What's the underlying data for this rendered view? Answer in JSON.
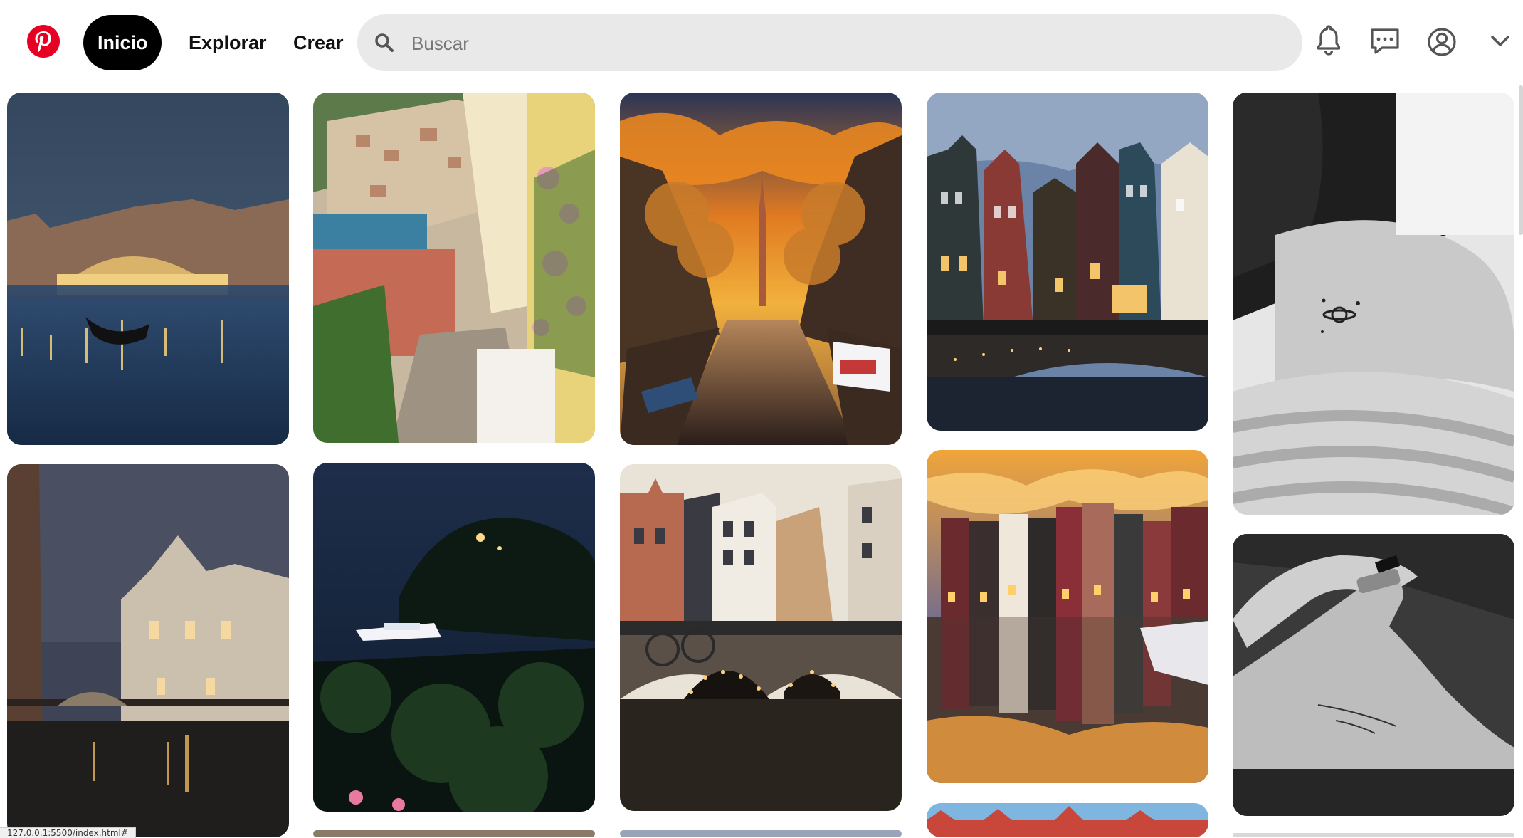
{
  "brand": {
    "logo_icon": "pinterest-logo-icon",
    "color": "#e60023"
  },
  "nav": {
    "home_label": "Inicio",
    "explore_label": "Explorar",
    "create_label": "Crear"
  },
  "search": {
    "placeholder": "Buscar",
    "value": "",
    "icon": "search-icon"
  },
  "header_icons": [
    "bell-icon",
    "message-icon",
    "profile-icon",
    "chevron-down-icon"
  ],
  "pins": [
    {
      "subject": "Rialto Bridge, Venice at night with gondola"
    },
    {
      "subject": "Positano coastline with pink flowers and stone stairs"
    },
    {
      "subject": "Amsterdam canal at sunset with church tower"
    },
    {
      "subject": "Amsterdam canal houses at dusk"
    },
    {
      "subject": "Shoulder tattoo of a small planet"
    },
    {
      "subject": "Venice canal at night with illuminated palace"
    },
    {
      "subject": "Portofino bay at night with yacht"
    },
    {
      "subject": "Amsterdam bridge with lights and bicycles"
    },
    {
      "subject": "Damrak houses reflected in water at sunset"
    },
    {
      "subject": "Forearm tattoo with handwritten script"
    }
  ],
  "status_url": "127.0.0.1:5500/index.html#"
}
